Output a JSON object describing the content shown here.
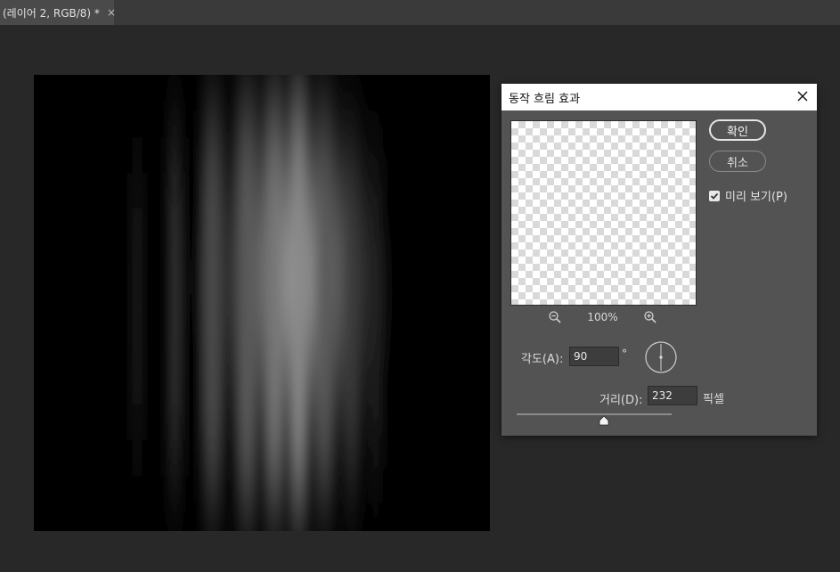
{
  "document_tab": {
    "title": "(레이어 2, RGB/8) *",
    "close_glyph": "×"
  },
  "dialog": {
    "title": "동작 흐림 효과",
    "ok_label": "확인",
    "cancel_label": "취소",
    "preview_label": "미리 보기(P)",
    "preview_checked": true,
    "zoom_level": "100%",
    "angle_label": "각도(A):",
    "angle_value": "90",
    "angle_unit": "°",
    "distance_label": "거리(D):",
    "distance_value": "232",
    "distance_unit": "픽셀"
  },
  "colors": {
    "workspace": "#282828",
    "dialog_bg": "#535353",
    "title_bar": "#ffffff",
    "canvas": "#000000"
  },
  "icons": [
    "close-icon",
    "zoom-out-icon",
    "zoom-in-icon",
    "checkmark-icon",
    "angle-dial-icon",
    "slider-thumb-icon"
  ]
}
